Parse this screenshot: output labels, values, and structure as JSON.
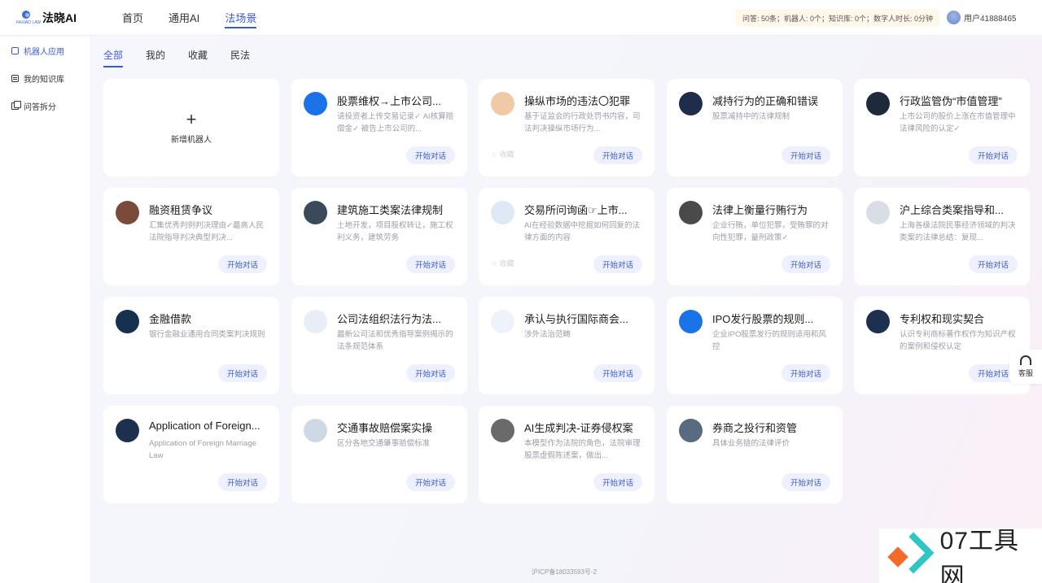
{
  "app": {
    "name": "法晓AI",
    "logo_text": "FAXIAO LAW"
  },
  "header": {
    "nav": [
      "首页",
      "通用AI",
      "法场景"
    ],
    "active_nav": 2,
    "quota": "问答: 50条；机器人: 0个；知识库: 0个；数字人时长: 0分钟",
    "user": "用户41888465"
  },
  "sidebar": {
    "items": [
      {
        "label": "机器人应用",
        "icon": "robot-icon"
      },
      {
        "label": "我的知识库",
        "icon": "document-icon"
      },
      {
        "label": "问答拆分",
        "icon": "copy-icon"
      }
    ]
  },
  "tabs": [
    "全部",
    "我的",
    "收藏",
    "民法"
  ],
  "new_card_label": "新增机器人",
  "start_label": "开始对话",
  "fav_label": "收藏",
  "cards": [
    {
      "title": "股票维权→上市公司...",
      "desc": "请投资者上传交易记录✓ AI核算赔偿金✓ 被告上市公司的...",
      "color": "#1a73e8",
      "icon": "chart-icon"
    },
    {
      "title": "操纵市场的违法〇犯罪",
      "desc": "基于证监会的行政处罚书内容，司法判决操纵市场行为...",
      "color": "#f0c9a8",
      "icon": "market-icon"
    },
    {
      "title": "减持行为的正确和错误",
      "desc": "股票减持中的法律规制",
      "color": "#1f2d4a",
      "icon": "stock-icon"
    },
    {
      "title": "行政监管伪“市值管理”",
      "desc": "上市公司的股价上涨在市值管理中法律风险的认定✓",
      "color": "#1d2a3a",
      "icon": "regulation-icon"
    },
    {
      "title": "融资租赁争议",
      "desc": "汇集优秀判例判决理由✓最高人民法院指导判决典型判决...",
      "color": "#7a4a3a",
      "icon": "lease-icon"
    },
    {
      "title": "建筑施工类案法律规制",
      "desc": "土地开发，项目股权转让，施工权利义务，建筑劳务",
      "color": "#3b4a5a",
      "icon": "building-icon"
    },
    {
      "title": "交易所问询函☞上市...",
      "desc": "AI在经验数据中挖掘如何回复的法律方面的内容",
      "color": "#dfe8f7",
      "icon": "exchange-icon"
    },
    {
      "title": "法律上衡量行贿行为",
      "desc": "企业行贿，单位犯罪，受贿罪的对向性犯罪，量刑政策✓",
      "color": "#4a4a4a",
      "icon": "bribe-icon"
    },
    {
      "title": "沪上综合类案指导和...",
      "desc": "上海各级法院民事经济领域的判决类案的法律总结：复现...",
      "color": "#d8dde6",
      "icon": "court-icon"
    },
    {
      "title": "金融借款",
      "desc": "银行金融业通用合同类案判决规则",
      "color": "#15314f",
      "icon": "finance-icon"
    },
    {
      "title": "公司法组织法行为法...",
      "desc": "最新公司法和优秀指导案例揭示的法条规范体系",
      "color": "#e8eef7",
      "icon": "company-law-icon"
    },
    {
      "title": "承认与执行国际商会...",
      "desc": "涉外法治范畴",
      "color": "#eef2fb",
      "icon": "arbitration-icon"
    },
    {
      "title": "IPO发行股票的规则...",
      "desc": "企业IPO股票发行的规则适用和风控",
      "color": "#1a73e8",
      "icon": "question-icon"
    },
    {
      "title": "专利权和现实契合",
      "desc": "认识专利商标著作权作为知识产权的案例和侵权认定",
      "color": "#1d3050",
      "icon": "patent-icon"
    },
    {
      "title": "Application of Foreign...",
      "desc": "Application of Foreign Marriage Law",
      "color": "#1d3050",
      "icon": "globe-icon"
    },
    {
      "title": "交通事故赔偿案实操",
      "desc": "区分各地交通肇事赔偿标准",
      "color": "#cfd9e6",
      "icon": "traffic-icon"
    },
    {
      "title": "AI生成判决-证券侵权案",
      "desc": "本模型作为法院的角色，法院审理股票虚假陈述案，做出...",
      "color": "#6a6a6a",
      "icon": "scale-icon"
    },
    {
      "title": "券商之投行和资管",
      "desc": "具体业务链的法律评价",
      "color": "#5a6a80",
      "icon": "broker-icon"
    }
  ],
  "fav_cards": [
    1,
    6
  ],
  "service_label": "客服",
  "icp": "沪ICP备18033593号-2",
  "watermark": "07工具网"
}
